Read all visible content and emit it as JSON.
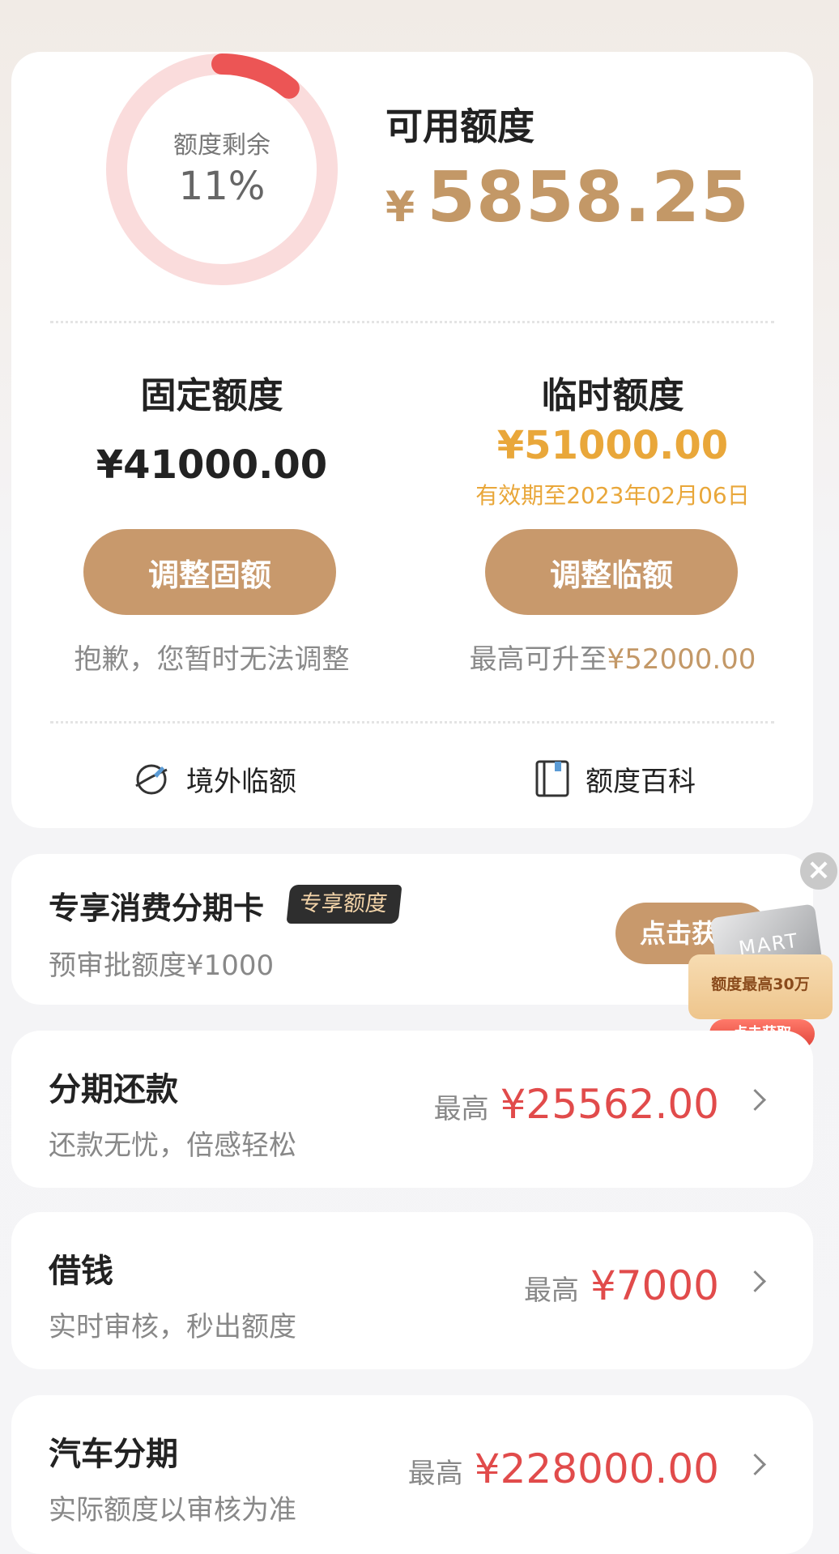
{
  "credit": {
    "ring_title": "额度剩余",
    "ring_percent_text": "11%",
    "ring_fraction": 0.11,
    "available_label": "可用额度",
    "available_currency": "¥",
    "available_amount": "5858.25",
    "fixed": {
      "label": "固定额度",
      "amount": "¥41000.00",
      "button": "调整固额",
      "note": "抱歉，您暂时无法调整"
    },
    "temporary": {
      "label": "临时额度",
      "amount": "¥51000.00",
      "expiry": "有效期至2023年02月06日",
      "button": "调整临额",
      "note_prefix": "最高可升至",
      "note_amount": "¥52000.00"
    },
    "quick_links": [
      {
        "label": "境外临额",
        "icon": "globe-plane-icon"
      },
      {
        "label": "额度百科",
        "icon": "book-icon"
      }
    ]
  },
  "promo": {
    "title": "专享消费分期卡",
    "badge": "专享额度",
    "subtitle": "预审批额度¥1000",
    "button": "点击获",
    "ad": {
      "card_text": "MART",
      "line": "额度最高30万",
      "button": "点击获取"
    }
  },
  "rows": [
    {
      "title": "分期还款",
      "subtitle": "还款无忧，倍感轻松",
      "prefix": "最高",
      "amount": "¥25562.00"
    },
    {
      "title": "借钱",
      "subtitle": "实时审核，秒出额度",
      "prefix": "最高",
      "amount": "¥7000"
    },
    {
      "title": "汽车分期",
      "subtitle": "实际额度以审核为准",
      "prefix": "最高",
      "amount": "¥228000.00"
    }
  ],
  "colors": {
    "gold": "#c39867",
    "button": "#c8996c",
    "orange": "#e9a73a",
    "red": "#e14b4b",
    "ring_track": "#fadcdc",
    "ring_fill": "#ec5555"
  }
}
